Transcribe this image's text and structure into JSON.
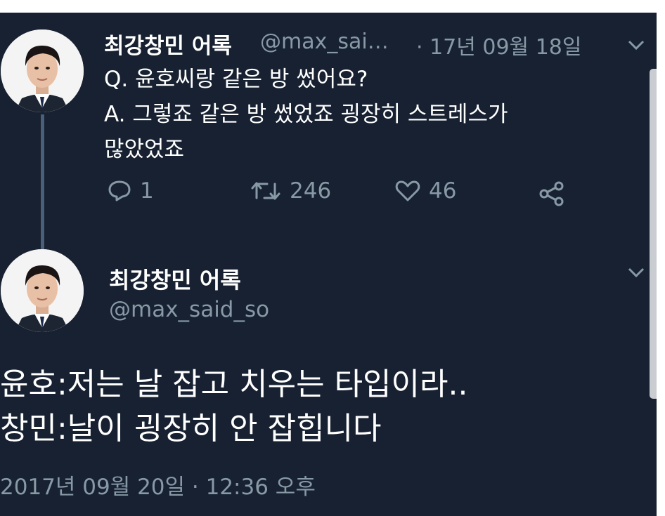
{
  "tweet1": {
    "display_name": "최강창민 어록",
    "handle": "@max_sai…",
    "date": "· 17년 09월 18일",
    "lines": [
      "Q. 윤호씨랑 같은 방 썼어요?",
      "A. 그렇죠 같은 방 썼었죠 굉장히 스트레스가",
      "많았었죠"
    ],
    "reply_count": "1",
    "retweet_count": "246",
    "like_count": "46"
  },
  "tweet2": {
    "display_name": "최강창민 어록",
    "handle": "@max_said_so",
    "lines": [
      "윤호:저는 날 잡고 치우는 타입이라..",
      "창민:날이 굉장히 안 잡힙니다"
    ],
    "timestamp": "2017년 09월 20일 · 12:36 오후"
  },
  "colors": {
    "background": "#172131",
    "text": "#ffffff",
    "muted": "#8899a6"
  },
  "icons": [
    "chevron-down-icon",
    "reply-icon",
    "retweet-icon",
    "like-icon",
    "share-icon"
  ]
}
